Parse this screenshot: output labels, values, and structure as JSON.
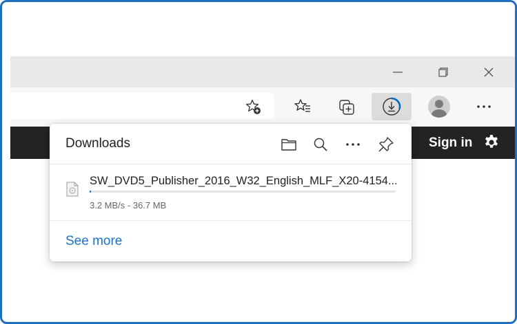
{
  "window": {
    "minimize_icon": "minimize-icon",
    "restore_icon": "restore-icon",
    "close_icon": "close-icon"
  },
  "toolbar": {
    "address_favorite_icon": "add-favorite-icon",
    "favorites_icon": "favorites-icon",
    "collections_icon": "collections-icon",
    "downloads_icon": "downloads-progress-icon",
    "profile_icon": "profile-avatar",
    "more_icon": "more-icon"
  },
  "site": {
    "sign_in_label": "Sign in",
    "settings_icon": "gear-icon",
    "background_color": "#232323"
  },
  "downloads": {
    "title": "Downloads",
    "header_icons": [
      "open-folder-icon",
      "search-icon",
      "more-icon",
      "pin-icon"
    ],
    "items": [
      {
        "file_name": "SW_DVD5_Publisher_2016_W32_English_MLF_X20-4154...",
        "status": "3.2 MB/s - 36.7 MB",
        "progress": 0.005
      }
    ],
    "see_more_label": "See more"
  },
  "colors": {
    "accent": "#0067c0",
    "link": "#1a73c8",
    "frame_border": "#1f6fbf"
  }
}
